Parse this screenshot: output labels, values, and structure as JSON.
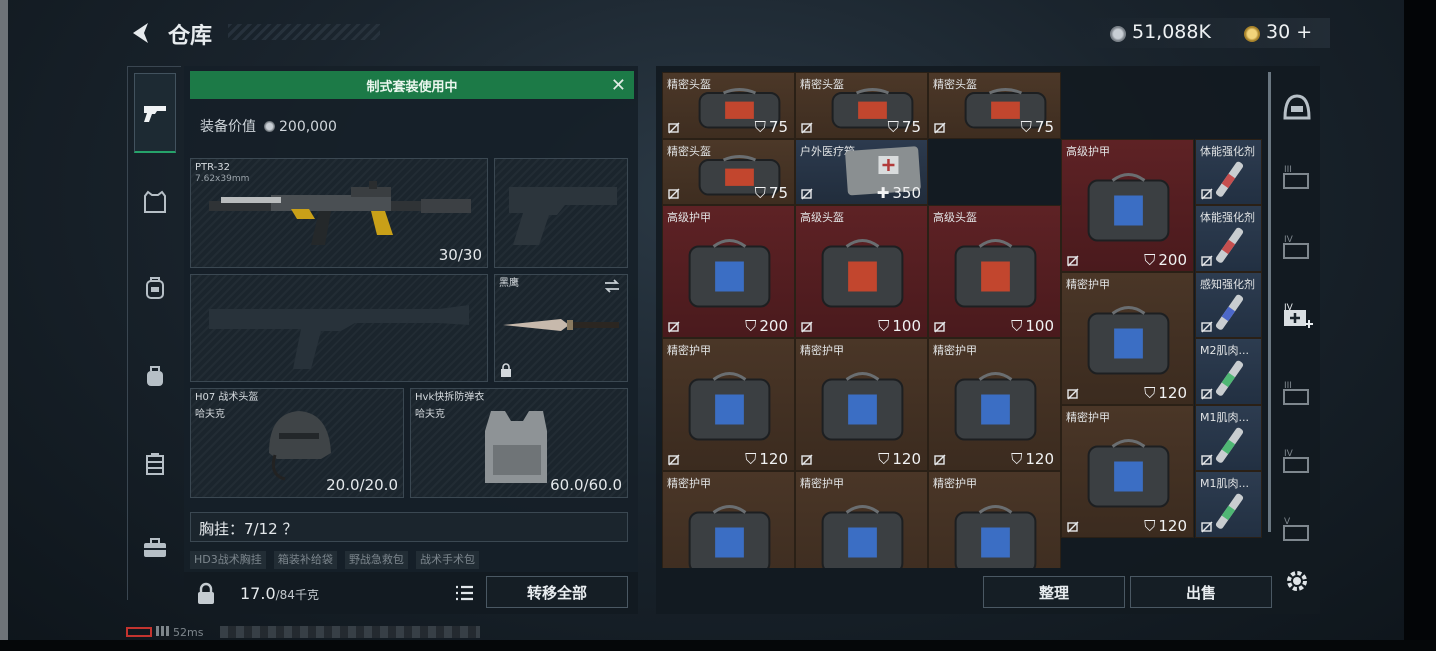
{
  "header": {
    "title": "仓库",
    "money": "51,088K",
    "gold": "30",
    "gold_plus": "+"
  },
  "loadout": {
    "banner": "制式套装使用中",
    "value_label": "装备价值",
    "value": "200,000",
    "primary": {
      "name": "PTR-32",
      "caliber": "7.62x39mm",
      "ammo": "30/30"
    },
    "melee": {
      "name": "黑鹰"
    },
    "helmet": {
      "name": "H07 战术头盔",
      "brand": "哈夫克",
      "durability": "20.0/20.0"
    },
    "armor": {
      "name": "Hvk快拆防弹衣",
      "brand": "哈夫克",
      "durability": "60.0/60.0"
    },
    "chest": "胸挂：7/12 ？",
    "chips": [
      "HD3战术胸挂",
      "箱装补给袋",
      "野战急救包",
      "战术手术包"
    ],
    "weight": "17.0",
    "weight_max": "/84千克",
    "transfer_all": "转移全部"
  },
  "storage": {
    "items": [
      {
        "name": "精密头盔",
        "value": "75",
        "kind": "helmet",
        "icon": "shield-icon"
      },
      {
        "name": "精密头盔",
        "value": "75",
        "kind": "helmet",
        "icon": "shield-icon"
      },
      {
        "name": "精密头盔",
        "value": "75",
        "kind": "helmet",
        "icon": "shield-icon"
      },
      {
        "name": "精密头盔",
        "value": "75",
        "kind": "helmet",
        "icon": "shield-icon"
      },
      {
        "name": "户外医疗箱",
        "value": "350",
        "kind": "med",
        "icon": "plus-icon"
      },
      {
        "name": "高级护甲",
        "value": "200",
        "kind": "armor",
        "icon": "shield-icon"
      },
      {
        "name": "体能强化剂",
        "value": "",
        "kind": "inj",
        "icon": ""
      },
      {
        "name": "体能强化剂",
        "value": "",
        "kind": "inj",
        "icon": ""
      },
      {
        "name": "高级护甲",
        "value": "200",
        "kind": "armor",
        "icon": "shield-icon"
      },
      {
        "name": "高级头盔",
        "value": "100",
        "kind": "helmet",
        "icon": "shield-icon"
      },
      {
        "name": "高级头盔",
        "value": "100",
        "kind": "helmet",
        "icon": "shield-icon"
      },
      {
        "name": "精密护甲",
        "value": "120",
        "kind": "armor",
        "icon": "shield-icon"
      },
      {
        "name": "感知强化剂",
        "value": "",
        "kind": "inj",
        "icon": ""
      },
      {
        "name": "精密护甲",
        "value": "120",
        "kind": "armor",
        "icon": "shield-icon"
      },
      {
        "name": "精密护甲",
        "value": "120",
        "kind": "armor",
        "icon": "shield-icon"
      },
      {
        "name": "精密护甲",
        "value": "120",
        "kind": "armor",
        "icon": "shield-icon"
      },
      {
        "name": "M2肌肉...",
        "value": "",
        "kind": "inj",
        "icon": ""
      },
      {
        "name": "精密护甲",
        "value": "120",
        "kind": "armor",
        "icon": "shield-icon"
      },
      {
        "name": "M1肌肉...",
        "value": "",
        "kind": "inj",
        "icon": ""
      },
      {
        "name": "精密护甲",
        "value": "",
        "kind": "armor",
        "icon": ""
      },
      {
        "name": "精密护甲",
        "value": "",
        "kind": "armor",
        "icon": ""
      },
      {
        "name": "精密护甲",
        "value": "",
        "kind": "armor",
        "icon": ""
      },
      {
        "name": "M1肌肉...",
        "value": "",
        "kind": "inj",
        "icon": ""
      }
    ],
    "sort": "整理",
    "sell": "出售"
  },
  "status": {
    "ping": "52ms"
  },
  "colors": {
    "accent_green": "#1c7a47",
    "brown_cell": "#4a3626",
    "red_cell": "#5c2023",
    "blue_cell": "#273548"
  }
}
